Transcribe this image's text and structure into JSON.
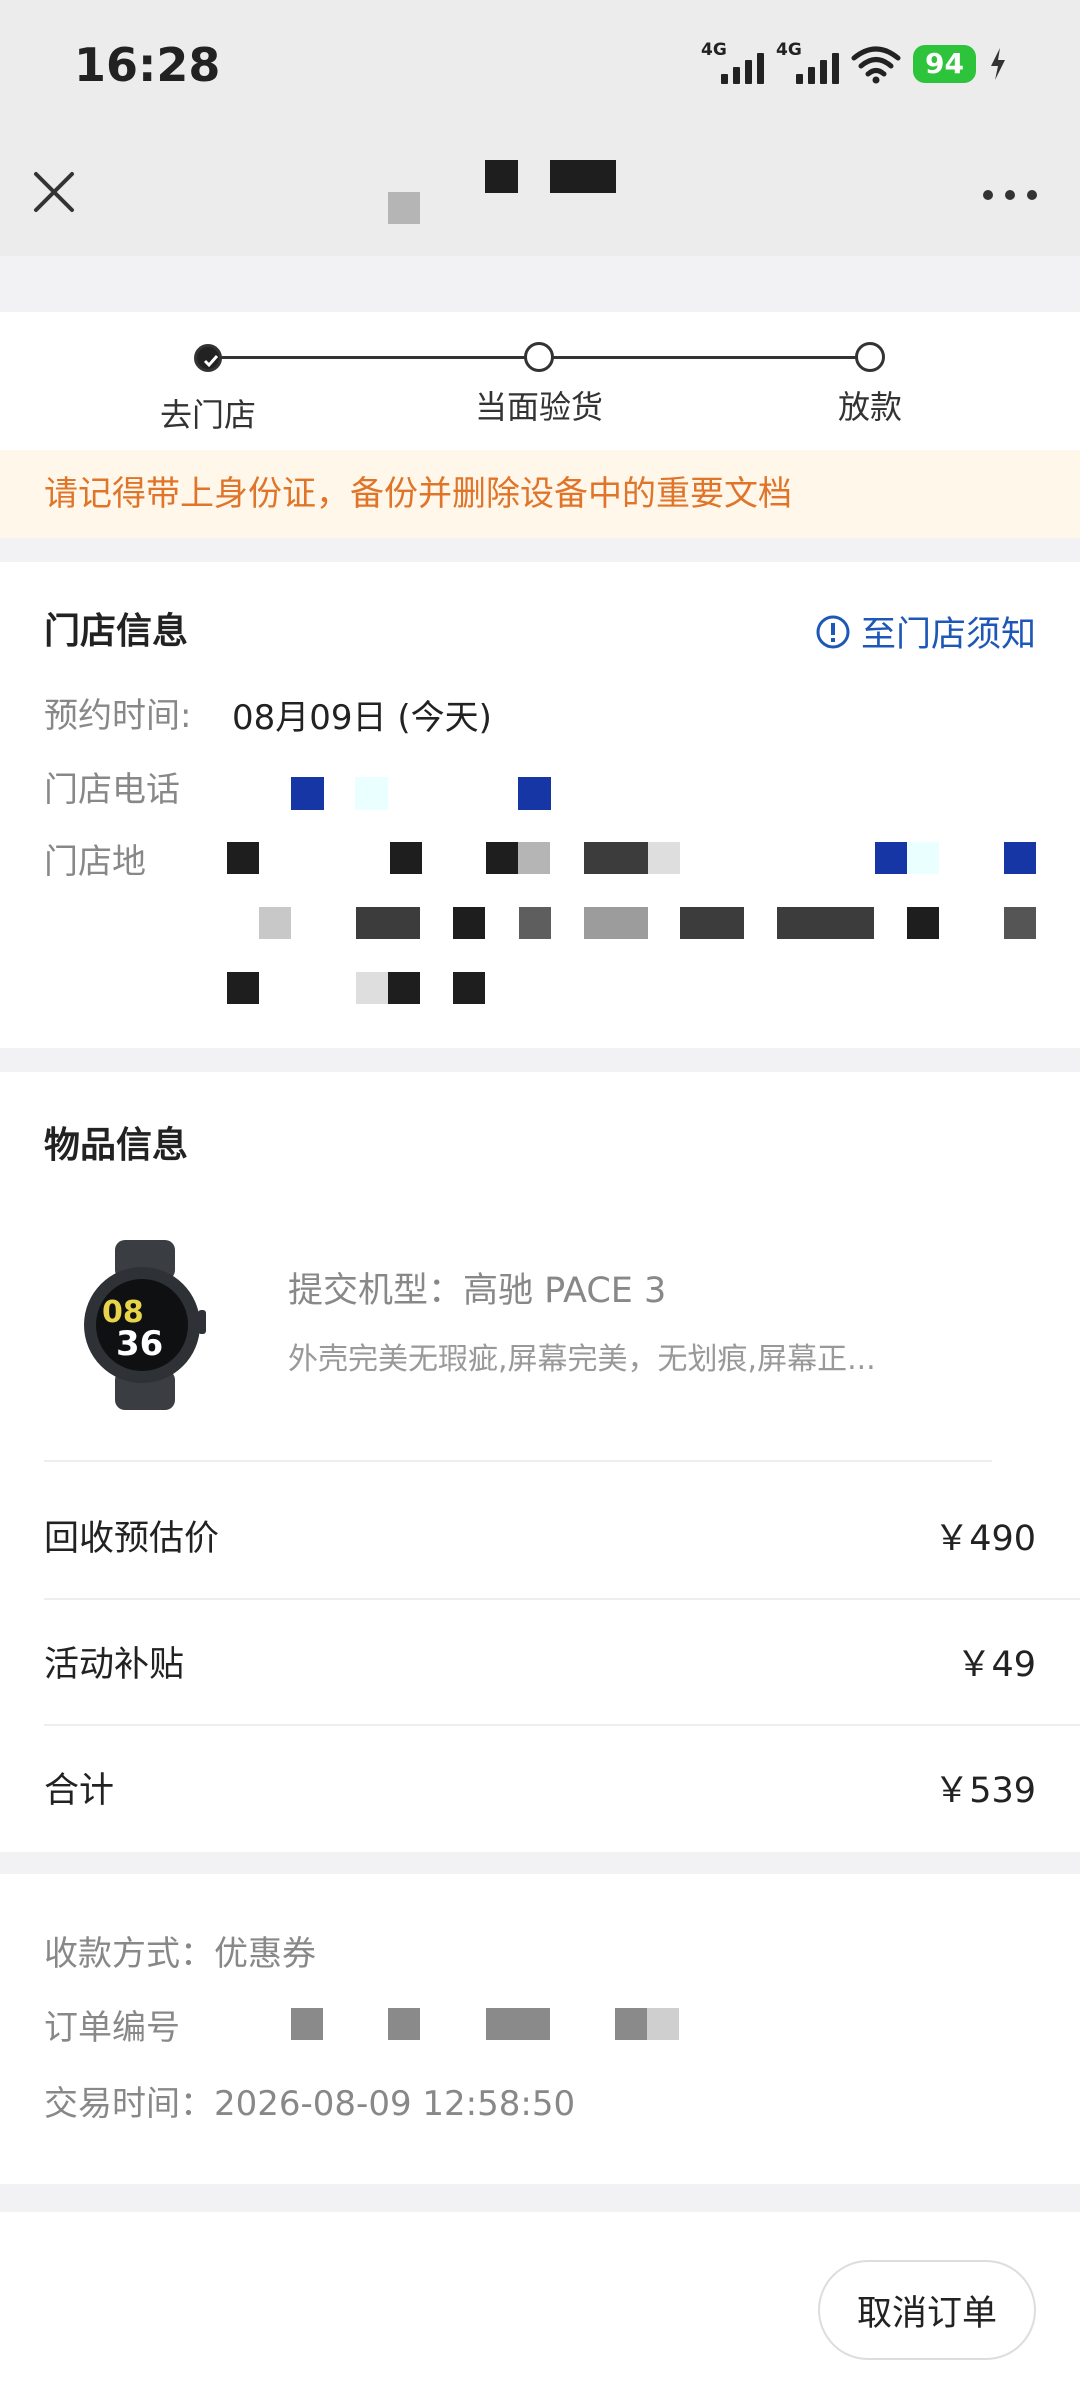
{
  "status_bar": {
    "time": "16:28",
    "signal_1_tag": "4G",
    "signal_2_tag": "4G",
    "battery": "94",
    "icons": [
      "signal-icon",
      "wifi-icon",
      "battery-icon",
      "charging-icon"
    ]
  },
  "nav": {
    "icons": [
      "close-icon",
      "more-icon"
    ]
  },
  "progress": {
    "steps": [
      "去门店",
      "当面验货",
      "放款"
    ],
    "current_step": 1
  },
  "notice": "请记得带上身份证，备份并删除设备中的重要文档",
  "store_info": {
    "title": "门店信息",
    "notice_link": "至门店须知",
    "appointment_label": "预约时间:",
    "appointment_value": "08月09日 (今天)",
    "phone_label": "门店电话",
    "address_label": "门店地"
  },
  "goods": {
    "title": "物品信息",
    "model": "提交机型：高驰 PACE 3",
    "description": "外壳完美无瑕疵,屏幕完美，无划痕,屏幕正...",
    "watch_time": [
      "08",
      "36"
    ]
  },
  "prices": [
    {
      "label": "回收预估价",
      "value": "￥490"
    },
    {
      "label": "活动补贴",
      "value": "￥49"
    },
    {
      "label": "合计",
      "value": "￥539"
    }
  ],
  "payment": {
    "method": "收款方式：优惠券",
    "order_no_label": "订单编号",
    "trade_time": "交易时间：2026-08-09 12:58:50"
  },
  "bottom": {
    "cancel_label": "取消订单"
  },
  "colors": {
    "accent_link": "#1d58b8",
    "notice_text": "#e0752a",
    "notice_bg": "#fff7ea",
    "battery": "#2dc43b"
  }
}
